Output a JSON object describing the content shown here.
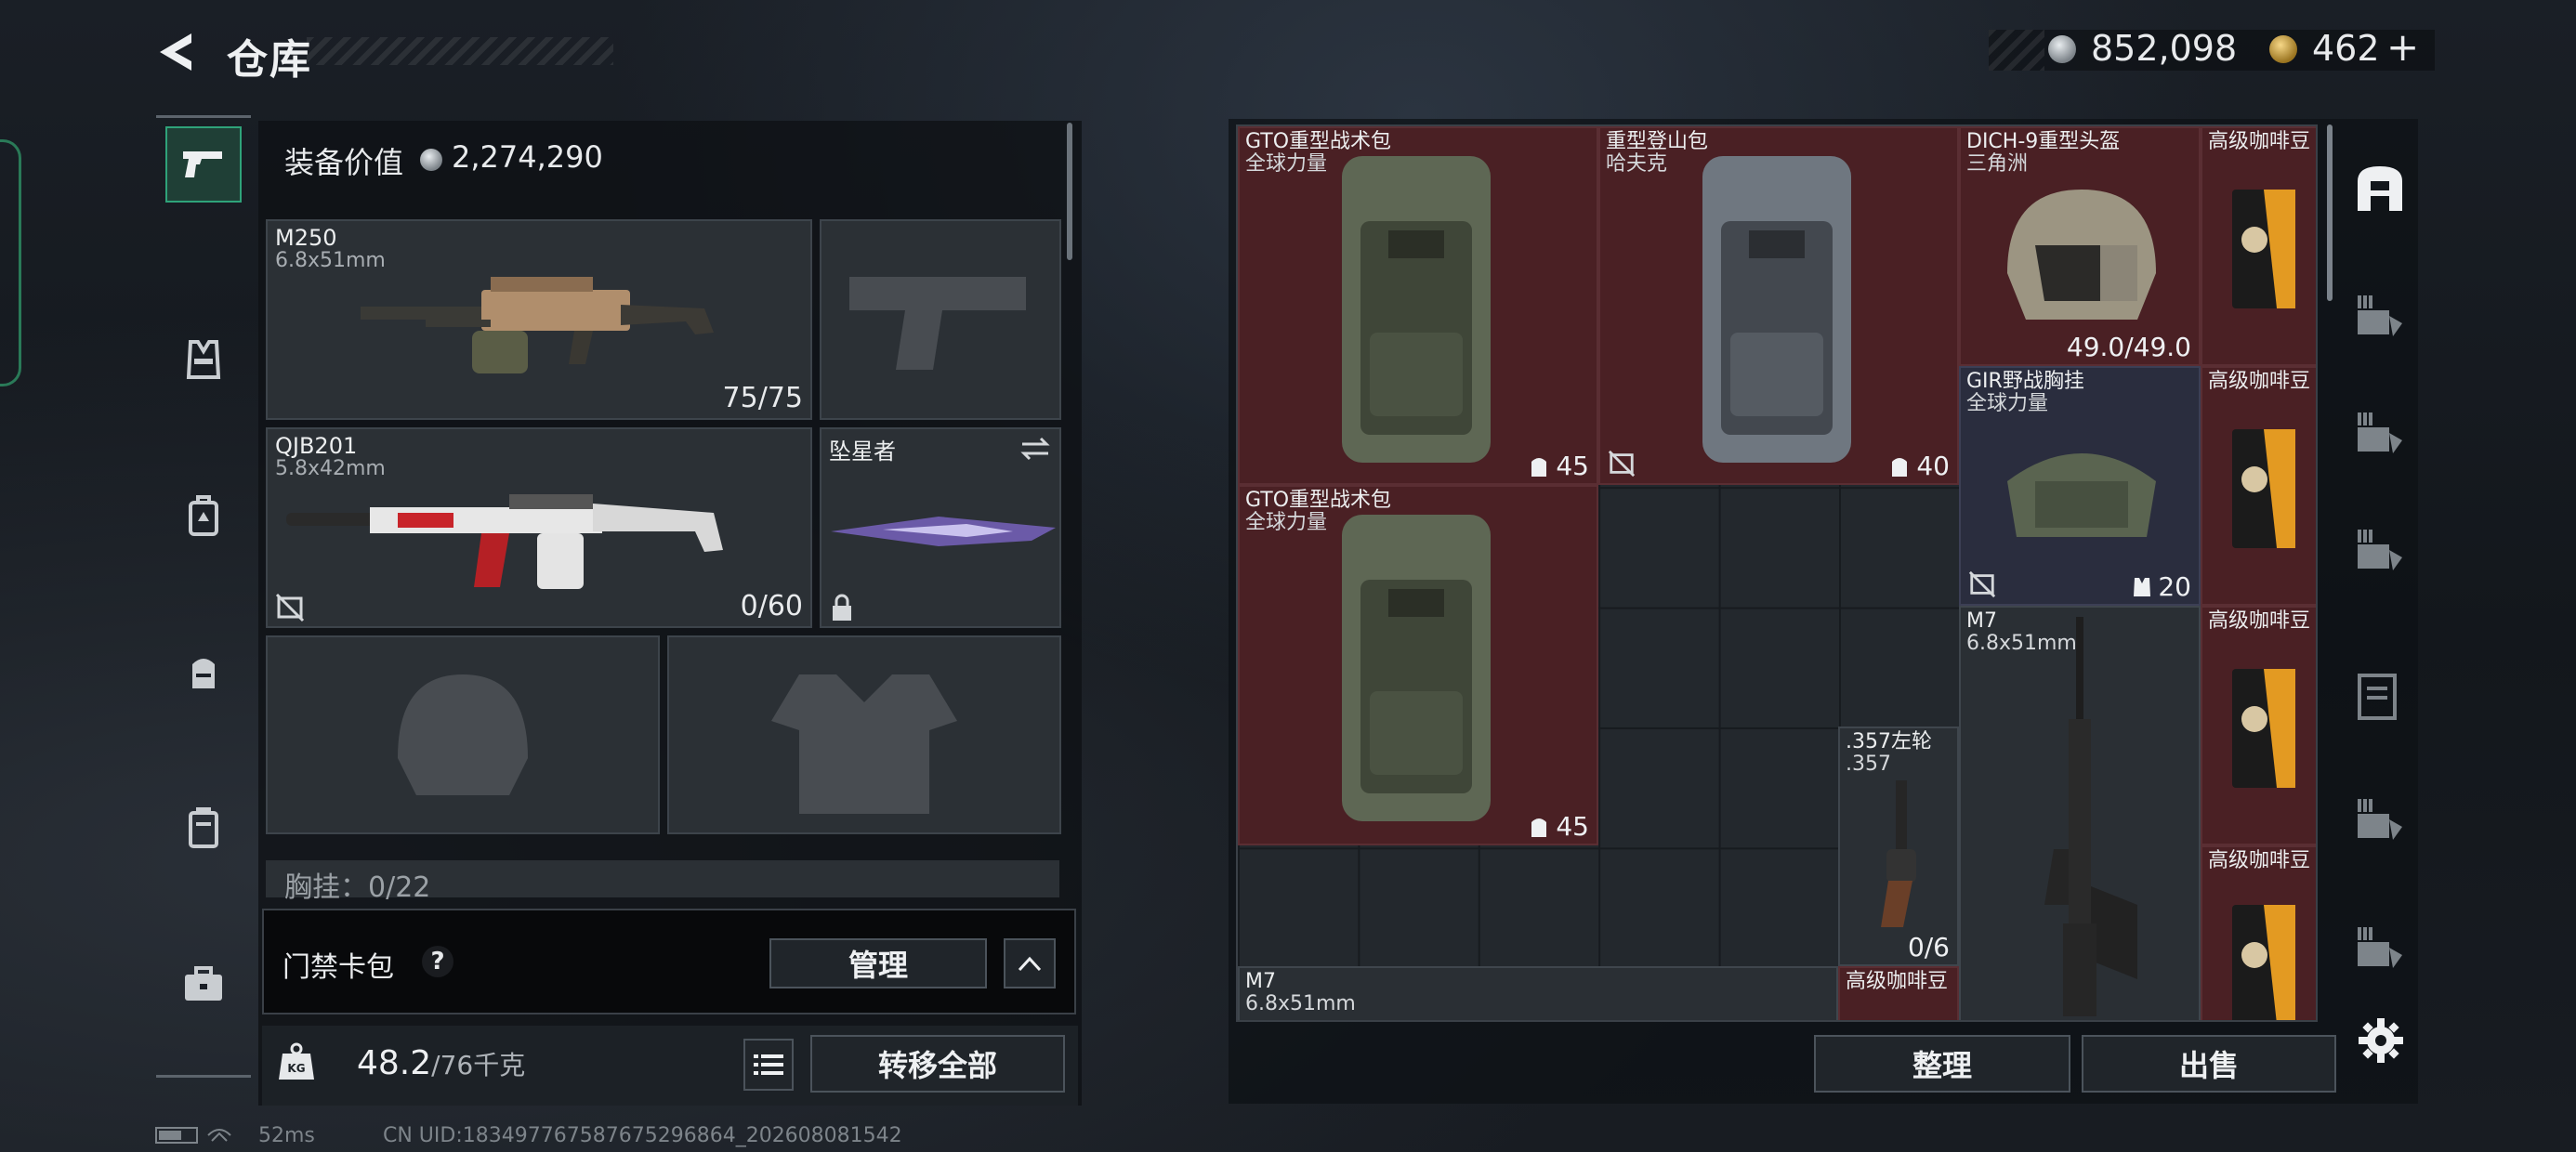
{
  "header": {
    "title": "仓库",
    "currency": {
      "silver": "852,098",
      "gold": "462",
      "add_symbol": "+"
    }
  },
  "nav": {
    "items": [
      {
        "name": "weapons",
        "icon": "pistol-icon",
        "active": true
      },
      {
        "name": "armor",
        "icon": "vest-icon"
      },
      {
        "name": "backpack-a",
        "icon": "backpack-icon"
      },
      {
        "name": "backpack-b",
        "icon": "pouch-icon"
      },
      {
        "name": "rig",
        "icon": "rig-icon"
      },
      {
        "name": "case",
        "icon": "case-icon"
      }
    ]
  },
  "loadout": {
    "value_label": "装备价值",
    "value": "2,274,290",
    "slots": {
      "primary": {
        "name": "M250",
        "caliber": "6.8x51mm",
        "ammo": "75/75"
      },
      "secondary": {
        "name": "QJB201",
        "caliber": "5.8x42mm",
        "ammo": "0/60"
      },
      "melee": {
        "name": "坠星者"
      }
    },
    "chest_rig_text": "胸挂：0/22",
    "card_pack": {
      "label": "门禁卡包",
      "help": "?",
      "manage": "管理",
      "collapse": "∧"
    },
    "weight": {
      "current": "48.2",
      "max": "/76千克",
      "kg_label": "KG"
    },
    "transfer_all": "转移全部"
  },
  "stash": {
    "items": [
      {
        "name": "GTO重型战术包",
        "sub": "全球力量",
        "capacity": "45",
        "color": "red"
      },
      {
        "name": "重型登山包",
        "sub": "哈夫克",
        "capacity": "40",
        "color": "red"
      },
      {
        "name": "DICH-9重型头盔",
        "sub": "三角洲",
        "durability": "49.0/49.0",
        "color": "red"
      },
      {
        "name": "高级咖啡豆",
        "color": "red"
      },
      {
        "name": "GIR野战胸挂",
        "sub": "全球力量",
        "capacity": "20",
        "color": "purple"
      },
      {
        "name": "高级咖啡豆",
        "color": "red"
      },
      {
        "name": "GTO重型战术包",
        "sub": "全球力量",
        "capacity": "45",
        "color": "red"
      },
      {
        "name": "M7",
        "sub": "6.8x51mm",
        "color": "gray"
      },
      {
        "name": "高级咖啡豆",
        "color": "red"
      },
      {
        "name": ".357左轮",
        "sub": ".357",
        "ammo": "0/6",
        "color": "gray"
      },
      {
        "name": "高级咖啡豆",
        "color": "red"
      },
      {
        "name": "M7",
        "sub": "6.8x51mm",
        "color": "gray"
      },
      {
        "name": "高级咖啡豆",
        "color": "red"
      }
    ],
    "sort": "整理",
    "sell": "出售"
  },
  "rail": {
    "items": [
      "all-items-icon",
      "ammo-category-icon",
      "medical-category-icon",
      "gear-category-icon",
      "document-category-icon",
      "container-category-icon",
      "misc-category-icon"
    ]
  },
  "status": {
    "ping": "52ms",
    "uid": "CN UID:18349776758767529​6864_202608081542"
  },
  "colors": {
    "accent_green": "#2fa37a",
    "rare_red": "#4a2024",
    "epic_purple": "#2a2d3e"
  }
}
